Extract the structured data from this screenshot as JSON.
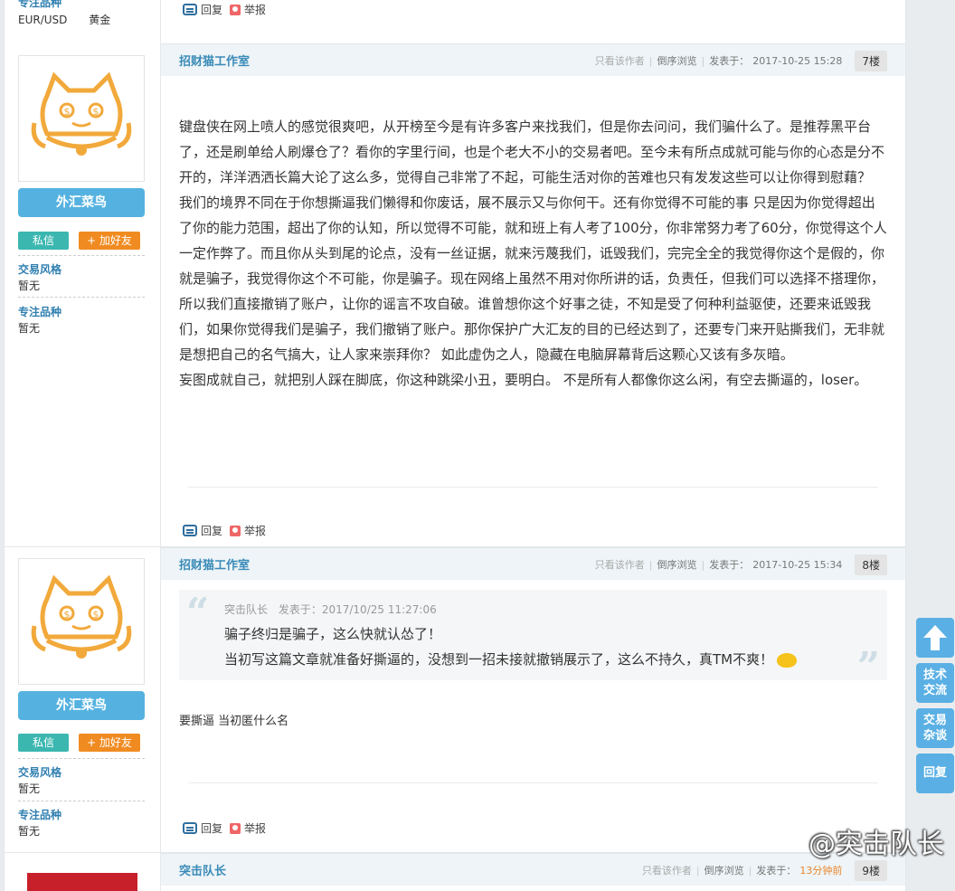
{
  "top_fragment": {
    "label": "专注品种",
    "value_a": "EUR/USD",
    "value_b": "黄金",
    "reply": "回复",
    "report": "举报"
  },
  "posts": [
    {
      "author": "招财猫工作室",
      "level": "外汇菜鸟",
      "pm": "私信",
      "add_friend": "+ 加好友",
      "style_label": "交易风格",
      "style_value": "暂无",
      "focus_label": "专注品种",
      "focus_value": "暂无",
      "only_author": "只看该作者",
      "reverse": "倒序浏览",
      "posted_label": "发表于：",
      "posted_time": "2017-10-25 15:28",
      "floor": "7楼",
      "paragraphs": [
        "键盘侠在网上喷人的感觉很爽吧，从开榜至今是有许多客户来找我们，但是你去问问，我们骗什么了。是推荐黑平台了，还是刷单给人刷爆仓了？看你的字里行间，也是个老大不小的交易者吧。至今未有所点成就可能与你的心态是分不开的，洋洋洒洒长篇大论了这么多，觉得自己非常了不起，可能生活对你的苦难也只有发发这些可以让你得到慰藉？",
        "我们的境界不同在于你想撕逼我们懒得和你废话，展不展示又与你何干。还有你觉得不可能的事 只是因为你觉得超出了你的能力范围，超出了你的认知，所以觉得不可能，就和班上有人考了100分，你非常努力考了60分，你觉得这个人一定作弊了。而且你从头到尾的论点，没有一丝证据，就来污蔑我们，诋毁我们，完完全全的我觉得你这个是假的，你就是骗子，我觉得你这个不可能，你是骗子。现在网络上虽然不用对你所讲的话，负责任，但我们可以选择不搭理你，所以我们直接撤销了账户，让你的谣言不攻自破。谁曾想你这个好事之徒，不知是受了何种利益驱使，还要来诋毁我们，如果你觉得我们是骗子，我们撤销了账户。那你保护广大汇友的目的已经达到了，还要专门来开贴撕我们，无非就是想把自己的名气搞大，让人家来崇拜你？ 如此虚伪之人，隐藏在电脑屏幕背后这颗心又该有多灰暗。",
        "妄图成就自己，就把别人踩在脚底，你这种跳梁小丑，要明白。 不是所有人都像你这么闲，有空去撕逼的，loser。"
      ],
      "reply": "回复",
      "report": "举报"
    },
    {
      "author": "招财猫工作室",
      "level": "外汇菜鸟",
      "pm": "私信",
      "add_friend": "+ 加好友",
      "style_label": "交易风格",
      "style_value": "暂无",
      "focus_label": "专注品种",
      "focus_value": "暂无",
      "only_author": "只看该作者",
      "reverse": "倒序浏览",
      "posted_label": "发表于：",
      "posted_time": "2017-10-25 15:34",
      "floor": "8楼",
      "quote_author": "突击队长",
      "quote_time": "发表于：2017/10/25 11:27:06",
      "quote_line1": "骗子终归是骗子，这么快就认怂了！",
      "quote_line2": "当初写这篇文章就准备好撕逼的，没想到一招未接就撤销展示了，这么不持久，真TM不爽！",
      "body": "要撕逼 当初匿什么名",
      "reply": "回复",
      "report": "举报"
    },
    {
      "author": "突击队长",
      "only_author": "只看该作者",
      "reverse": "倒序浏览",
      "posted_label": "发表于：",
      "posted_time": "13分钟前",
      "floor": "9楼"
    }
  ],
  "float_nav": {
    "tech": "技术交流",
    "chat": "交易杂谈",
    "reply": "回复"
  },
  "watermark": "@突击队长",
  "colors": {
    "accent": "#55b2e0",
    "author": "#3a8bb8",
    "pm": "#3bb7b0",
    "add": "#f08b22"
  }
}
